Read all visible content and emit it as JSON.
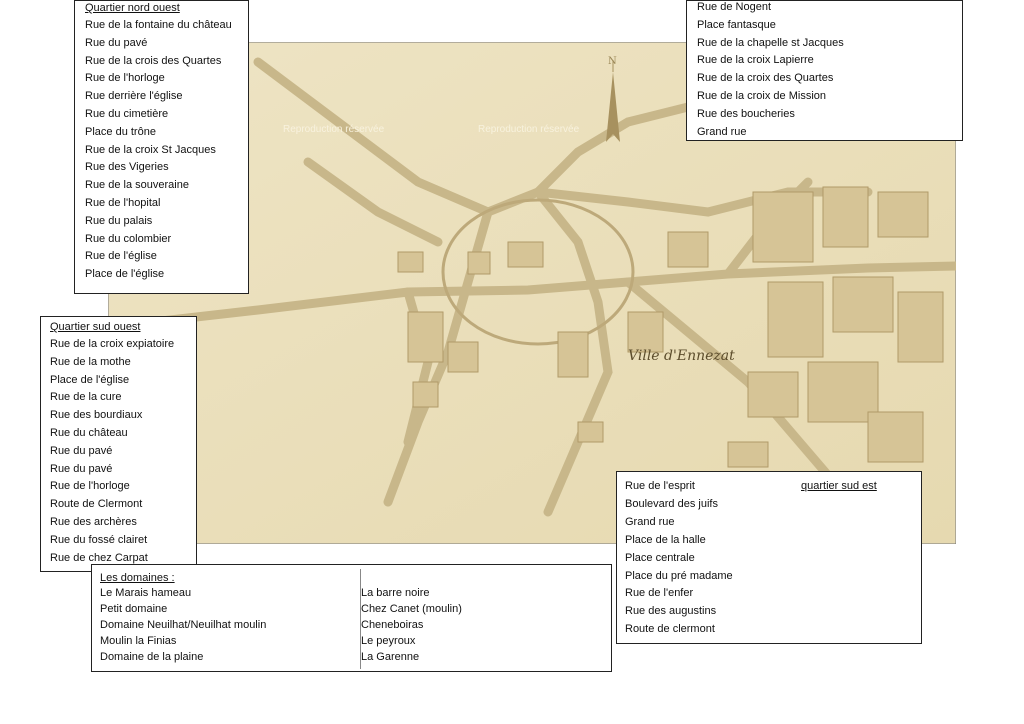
{
  "map": {
    "title": "Ville d'Ennezat",
    "watermark": "Reproduction réservée",
    "north_arrow": "N",
    "paper_color": "#ece1bd",
    "ink_color": "#b8a67a"
  },
  "nord_ouest": {
    "heading": "Quartier nord ouest",
    "streets": [
      "Rue de la fontaine du château",
      "Rue du pavé",
      "Rue de la crois des Quartes",
      "Rue de l'horloge",
      "Rue derrière l'église",
      "Rue du cimetière",
      "Place du trône",
      "Rue de la croix St Jacques",
      "Rue des Vigeries",
      "Rue de la souveraine",
      "Rue de l'hopital",
      "Rue du palais",
      "Rue du colombier",
      "Rue de l'église",
      "Place de l'église"
    ]
  },
  "nord_est": {
    "streets": [
      "Rue de Nogent",
      "Place fantasque",
      "Rue de la chapelle st Jacques",
      "Rue de la croix Lapierre",
      "Rue de la croix des Quartes",
      "Rue de la croix de Mission",
      "Rue des boucheries",
      "Grand rue"
    ]
  },
  "sud_ouest": {
    "heading": "Quartier sud ouest",
    "streets": [
      "Rue de la croix expiatoire",
      "Rue de la mothe",
      "Place de l'église",
      "Rue de la cure",
      "Rue des bourdiaux",
      "Rue du château",
      "Rue du pavé",
      "Rue du pavé",
      "Rue de l'horloge",
      "Route de Clermont",
      "Rue des archères",
      "Rue du fossé clairet",
      "Rue de chez Carpat"
    ]
  },
  "sud_est": {
    "heading": "quartier sud est",
    "streets": [
      "Rue de l'esprit",
      "Boulevard des juifs",
      "Grand rue",
      "Place de la halle",
      "Place centrale",
      "Place du pré madame",
      "Rue de l'enfer",
      "Rue des augustins",
      "Route de clermont"
    ]
  },
  "domaines": {
    "heading": "Les domaines :",
    "col1": [
      "Le Marais hameau",
      "Petit domaine",
      "Domaine Neuilhat/Neuilhat moulin",
      "Moulin la Finias",
      "Domaine de la plaine"
    ],
    "col2": [
      "La barre noire",
      "Chez Canet (moulin)",
      "Cheneboiras",
      "Le peyroux",
      "La Garenne"
    ]
  }
}
